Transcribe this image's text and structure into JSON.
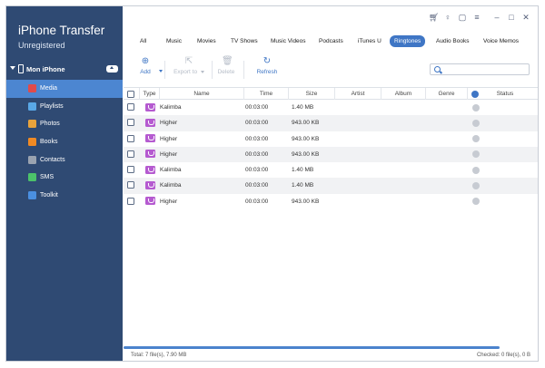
{
  "app": {
    "title": "iPhone Transfer",
    "subtitle": "Unregistered"
  },
  "device": {
    "name": "Mon iPhone"
  },
  "sidebar": {
    "items": [
      {
        "label": "Media",
        "icon": "media-icon",
        "color": "#e04b4b",
        "active": true
      },
      {
        "label": "Playlists",
        "icon": "playlist-icon",
        "color": "#59a8e6"
      },
      {
        "label": "Photos",
        "icon": "photos-icon",
        "color": "#e8a33c"
      },
      {
        "label": "Books",
        "icon": "books-icon",
        "color": "#f08a24"
      },
      {
        "label": "Contacts",
        "icon": "contacts-icon",
        "color": "#9aa3b0"
      },
      {
        "label": "SMS",
        "icon": "sms-icon",
        "color": "#4cc26a"
      },
      {
        "label": "Toolkit",
        "icon": "toolkit-icon",
        "color": "#4a8fe0"
      }
    ]
  },
  "titlebar_icons": [
    "cart-icon",
    "key-icon",
    "feedback-icon",
    "menu-icon",
    "minimize-icon",
    "maximize-icon",
    "close-icon"
  ],
  "tabs": [
    {
      "label": "All"
    },
    {
      "label": "Music"
    },
    {
      "label": "Movies"
    },
    {
      "label": "TV Shows"
    },
    {
      "label": "Music Videos"
    },
    {
      "label": "Podcasts"
    },
    {
      "label": "iTunes U"
    },
    {
      "label": "Ringtones",
      "active": true
    },
    {
      "label": "Audio Books"
    },
    {
      "label": "Voice Memos"
    }
  ],
  "toolbar": {
    "add": "Add",
    "export": "Export to",
    "delete": "Delete",
    "refresh": "Refresh"
  },
  "search": {
    "placeholder": ""
  },
  "table": {
    "headers": [
      "Type",
      "Name",
      "Time",
      "Size",
      "Artist",
      "Album",
      "Genre",
      "Status"
    ],
    "rows": [
      {
        "name": "Kalimba",
        "time": "00:03:00",
        "size": "1.40 MB"
      },
      {
        "name": "Higher",
        "time": "00:03:00",
        "size": "943.00 KB"
      },
      {
        "name": "Higher",
        "time": "00:03:00",
        "size": "943.00 KB"
      },
      {
        "name": "Higher",
        "time": "00:03:00",
        "size": "943.00 KB"
      },
      {
        "name": "Kalimba",
        "time": "00:03:00",
        "size": "1.40 MB"
      },
      {
        "name": "Kalimba",
        "time": "00:03:00",
        "size": "1.40 MB"
      },
      {
        "name": "Higher",
        "time": "00:03:00",
        "size": "943.00 KB"
      }
    ]
  },
  "footer": {
    "total": "Total: 7 file(s), 7.90 MB",
    "checked": "Checked: 0 file(s), 0 B"
  },
  "colors": {
    "sidebar": "#2f4a73",
    "accent": "#3f76c5",
    "active_item": "#4c86d1",
    "ringtone": "#b55ad0"
  }
}
